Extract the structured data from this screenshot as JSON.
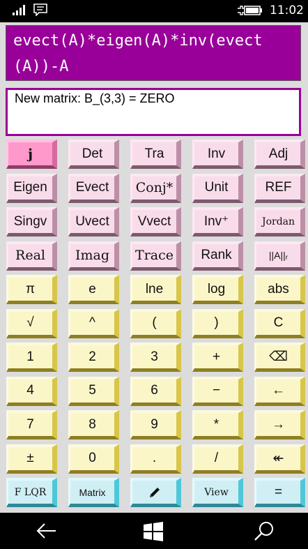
{
  "status": {
    "time": "11:02"
  },
  "formula": "evect(A)*eigen(A)*inv(evect(A))-A",
  "result": "New matrix: B_(3,3) = ZERO",
  "rows": [
    [
      {
        "label": "j",
        "style": "hot",
        "font": "serif"
      },
      {
        "label": "Det",
        "style": "pink"
      },
      {
        "label": "Tra",
        "style": "pink"
      },
      {
        "label": "Inv",
        "style": "pink"
      },
      {
        "label": "Adj",
        "style": "pink"
      }
    ],
    [
      {
        "label": "Eigen",
        "style": "pink"
      },
      {
        "label": "Evect",
        "style": "pink"
      },
      {
        "label": "Conj*",
        "style": "pink",
        "font": "serif"
      },
      {
        "label": "Unit",
        "style": "pink"
      },
      {
        "label": "REF",
        "style": "pink"
      }
    ],
    [
      {
        "label": "Singv",
        "style": "pink"
      },
      {
        "label": "Uvect",
        "style": "pink"
      },
      {
        "label": "Vvect",
        "style": "pink"
      },
      {
        "label": "Inv⁺",
        "style": "pink"
      },
      {
        "label": "Jordan",
        "style": "pink",
        "font": "serif",
        "size": "small"
      }
    ],
    [
      {
        "label": "Real",
        "style": "pink",
        "font": "serif"
      },
      {
        "label": "Imag",
        "style": "pink",
        "font": "serif"
      },
      {
        "label": "Trace",
        "style": "pink",
        "font": "serif"
      },
      {
        "label": "Rank",
        "style": "pink"
      },
      {
        "label": "||A||ᵣ",
        "style": "pink",
        "size": "small"
      }
    ],
    [
      {
        "label": "π",
        "style": "yel"
      },
      {
        "label": "e",
        "style": "yel"
      },
      {
        "label": "lne",
        "style": "yel"
      },
      {
        "label": "log",
        "style": "yel"
      },
      {
        "label": "abs",
        "style": "yel"
      }
    ],
    [
      {
        "label": "√",
        "style": "yel"
      },
      {
        "label": "^",
        "style": "yel"
      },
      {
        "label": "(",
        "style": "yel"
      },
      {
        "label": ")",
        "style": "yel"
      },
      {
        "label": "C",
        "style": "yel"
      }
    ],
    [
      {
        "label": "1",
        "style": "yel"
      },
      {
        "label": "2",
        "style": "yel"
      },
      {
        "label": "3",
        "style": "yel"
      },
      {
        "label": "+",
        "style": "yel"
      },
      {
        "label": "⌫",
        "style": "yel"
      }
    ],
    [
      {
        "label": "4",
        "style": "yel"
      },
      {
        "label": "5",
        "style": "yel"
      },
      {
        "label": "6",
        "style": "yel"
      },
      {
        "label": "−",
        "style": "yel"
      },
      {
        "label": "←",
        "style": "yel"
      }
    ],
    [
      {
        "label": "7",
        "style": "yel"
      },
      {
        "label": "8",
        "style": "yel"
      },
      {
        "label": "9",
        "style": "yel"
      },
      {
        "label": "*",
        "style": "yel"
      },
      {
        "label": "→",
        "style": "yel"
      }
    ],
    [
      {
        "label": "±",
        "style": "yel"
      },
      {
        "label": "0",
        "style": "yel"
      },
      {
        "label": ".",
        "style": "yel"
      },
      {
        "label": "/",
        "style": "yel"
      },
      {
        "label": "↞",
        "style": "yel"
      }
    ],
    [
      {
        "label": "F LQR",
        "style": "cyan",
        "font": "serif",
        "size": "small"
      },
      {
        "label": "Matrix",
        "style": "cyan",
        "size": "small"
      },
      {
        "label": "",
        "style": "cyan",
        "icon": "pencil-icon"
      },
      {
        "label": "View",
        "style": "cyan",
        "font": "serif",
        "size": "small"
      },
      {
        "label": "=",
        "style": "cyan"
      }
    ]
  ]
}
